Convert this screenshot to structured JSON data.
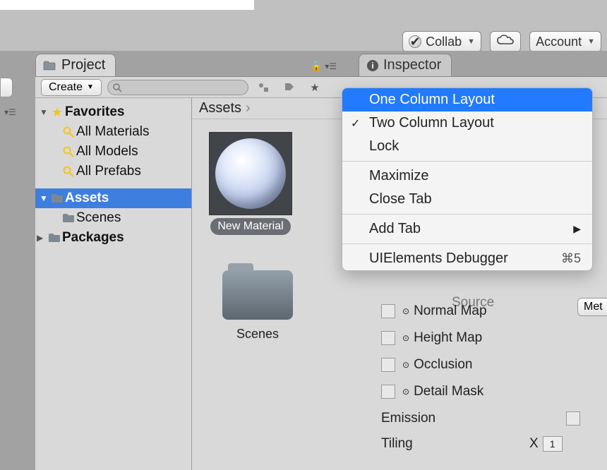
{
  "toolbar": {
    "collab": "Collab",
    "account": "Account"
  },
  "tabs": {
    "project": "Project",
    "inspector": "Inspector"
  },
  "project_toolbar": {
    "create": "Create"
  },
  "sidebar": {
    "favorites": "Favorites",
    "fav_items": [
      "All Materials",
      "All Models",
      "All Prefabs"
    ],
    "assets": "Assets",
    "assets_children": [
      "Scenes"
    ],
    "packages": "Packages"
  },
  "breadcrumb": {
    "root": "Assets"
  },
  "assets": {
    "material_label": "New Material",
    "scenes_label": "Scenes"
  },
  "context_menu": {
    "one_col": "One Column Layout",
    "two_col": "Two Column Layout",
    "lock": "Lock",
    "maximize": "Maximize",
    "close_tab": "Close Tab",
    "add_tab": "Add Tab",
    "uie_debugger": "UIElements Debugger",
    "uie_shortcut": "⌘5"
  },
  "inspector": {
    "source": "Source",
    "meta_btn": "Met",
    "normal_map": "Normal Map",
    "height_map": "Height Map",
    "occlusion": "Occlusion",
    "detail_mask": "Detail Mask",
    "emission": "Emission",
    "tiling": "Tiling",
    "tiling_x_label": "X",
    "tiling_x_value": "1"
  }
}
